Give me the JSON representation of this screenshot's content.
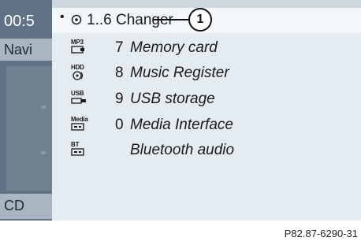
{
  "background": {
    "clock": "00:5",
    "nav_tab": "Navi",
    "cd_tab": "CD"
  },
  "selected": {
    "bullet": "•",
    "label": "1..6 Changer"
  },
  "items": [
    {
      "icon_tag": "MP3",
      "icon": "memory-card-icon",
      "num": "7",
      "label": "Memory card"
    },
    {
      "icon_tag": "HDD",
      "icon": "hard-disk-icon",
      "num": "8",
      "label": "Music Register"
    },
    {
      "icon_tag": "USB",
      "icon": "usb-icon",
      "num": "9",
      "label": "USB storage"
    },
    {
      "icon_tag": "Media",
      "icon": "media-interface-icon",
      "num": "0",
      "label": "Media Interface"
    },
    {
      "icon_tag": "BT",
      "icon": "bluetooth-audio-icon",
      "num": "",
      "label": "Bluetooth audio"
    }
  ],
  "callout_number": "1",
  "reference": "P82.87-6290-31",
  "colors": {
    "list_bg": "#e4ebf1",
    "side_bg": "#5f7384",
    "tab_bg": "#a9b6c2"
  }
}
